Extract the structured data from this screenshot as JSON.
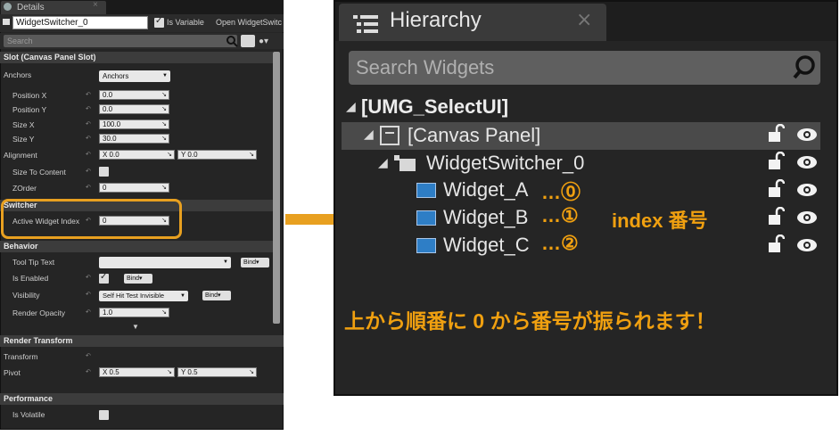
{
  "details": {
    "tab_title": "Details",
    "widget_name": "WidgetSwitcher_0",
    "is_variable_label": "Is Variable",
    "is_variable_checked": true,
    "open_button": "Open WidgetSwitc",
    "search_placeholder": "Search",
    "slot_section": "Slot (Canvas Panel Slot)",
    "anchors_label": "Anchors",
    "anchors_value": "Anchors",
    "position_x_label": "Position X",
    "position_x_value": "0.0",
    "position_y_label": "Position Y",
    "position_y_value": "0.0",
    "size_x_label": "Size X",
    "size_x_value": "100.0",
    "size_y_label": "Size Y",
    "size_y_value": "30.0",
    "alignment_label": "Alignment",
    "alignment_x": "X  0.0",
    "alignment_y": "Y  0.0",
    "size_to_content_label": "Size To Content",
    "zorder_label": "ZOrder",
    "zorder_value": "0",
    "switcher_section": "Switcher",
    "active_widget_index_label": "Active Widget Index",
    "active_widget_index_value": "0",
    "behavior_section": "Behavior",
    "tooltip_label": "Tool Tip Text",
    "bind_label": "Bind",
    "is_enabled_label": "Is Enabled",
    "visibility_label": "Visibility",
    "visibility_value": "Self Hit Test Invisible",
    "render_opacity_label": "Render Opacity",
    "render_opacity_value": "1.0",
    "render_transform_section": "Render Transform",
    "transform_label": "Transform",
    "pivot_label": "Pivot",
    "pivot_x": "X  0.5",
    "pivot_y": "Y  0.5",
    "performance_section": "Performance",
    "is_volatile_label": "Is Volatile"
  },
  "hierarchy": {
    "tab_title": "Hierarchy",
    "search_placeholder": "Search Widgets",
    "root": "[UMG_SelectUI]",
    "canvas_panel": "[Canvas Panel]",
    "switcher": "WidgetSwitcher_0",
    "widgets": [
      {
        "name": "Widget_A",
        "index": "…⓪"
      },
      {
        "name": "Widget_B",
        "index": "…①"
      },
      {
        "name": "Widget_C",
        "index": "…②"
      }
    ]
  },
  "annotations": {
    "index_note": "index 番号",
    "bottom_note": "上から順番に 0 から番号が振られます！",
    "accent_color": "#e8a020"
  }
}
